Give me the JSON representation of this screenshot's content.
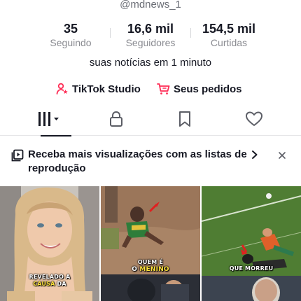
{
  "profile": {
    "handle": "@mdnews_1",
    "bio": "suas notícias em 1 minuto"
  },
  "stats": [
    {
      "value": "35",
      "label": "Seguindo"
    },
    {
      "value": "16,6 mil",
      "label": "Seguidores"
    },
    {
      "value": "154,5 mil",
      "label": "Curtidas"
    }
  ],
  "links": {
    "studio_label": "TikTok Studio",
    "orders_label": "Seus pedidos"
  },
  "tabs": [
    {
      "name": "videos",
      "icon": "grid-icon",
      "active": true
    },
    {
      "name": "private",
      "icon": "lock-icon"
    },
    {
      "name": "favorites",
      "icon": "bookmark-icon"
    },
    {
      "name": "liked",
      "icon": "heart-icon"
    }
  ],
  "banner": {
    "text": "Receba mais visualizações com as listas de reprodução"
  },
  "videos": [
    {
      "caption_line1": "REVELADO A",
      "caption_line2_hl": "CAUSA",
      "caption_line2_rest": " DA"
    },
    {
      "caption_line1": "QUEM É",
      "caption_line2_pre": "O ",
      "caption_line2_hl": "MENINO"
    },
    {
      "caption_line1": "QUE MORREU"
    }
  ],
  "colors": {
    "text": "#161823",
    "muted": "#8a8b91",
    "accent": "#fe2c55",
    "caption_highlight": "#ffe23a"
  }
}
